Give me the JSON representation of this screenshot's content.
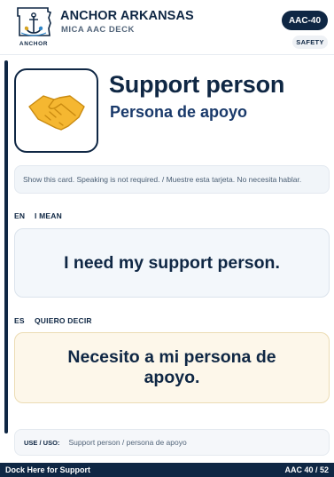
{
  "header": {
    "brand_title": "ANCHOR ARKANSAS",
    "brand_subtitle": "MICA AAC DECK",
    "logo_text": "ANCHOR",
    "card_code": "AAC-40",
    "category": "SAFETY"
  },
  "hero": {
    "symbol_icon": "handshake-icon",
    "title_en": "Support person",
    "title_es": "Persona de apoyo"
  },
  "instruction": "Show this card. Speaking is not required. / Muestre esta tarjeta. No necesita hablar.",
  "english": {
    "code": "EN",
    "label": "I MEAN",
    "phrase": "I need my support person."
  },
  "spanish": {
    "code": "ES",
    "label": "QUIERO DECIR",
    "phrase": "Necesito a mi persona de apoyo."
  },
  "usage": {
    "label": "USE / USO:",
    "text": "Support person / persona de apoyo"
  },
  "footer": {
    "left": "Dock Here for Support",
    "right": "AAC 40 / 52"
  },
  "colors": {
    "navy": "#0f2744",
    "english_panel": "#f3f7fb",
    "spanish_panel": "#fdf7ea",
    "handshake": "#f5b731"
  }
}
